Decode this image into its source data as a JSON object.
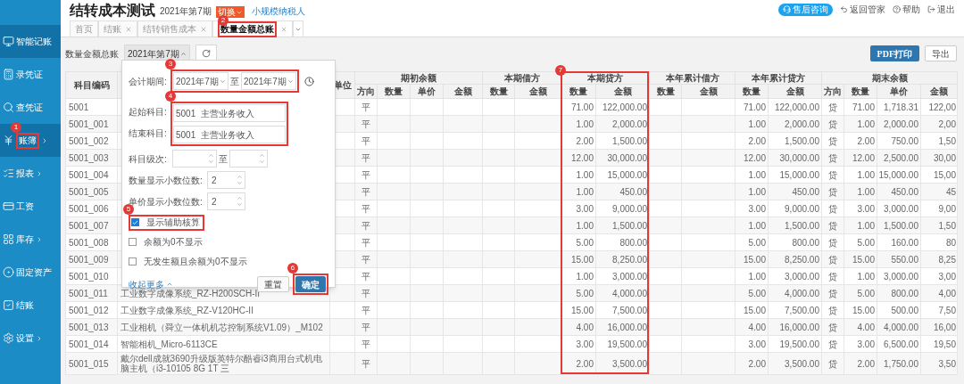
{
  "sidebar": {
    "items": [
      {
        "label": "智能记账",
        "selected": true,
        "submenu": false
      },
      {
        "label": "录凭证",
        "selected": false,
        "submenu": false
      },
      {
        "label": "查凭证",
        "selected": false,
        "submenu": false
      },
      {
        "label": "账簿",
        "selected": true,
        "submenu": true,
        "marker": "1"
      },
      {
        "label": "报表",
        "selected": false,
        "submenu": true
      },
      {
        "label": "工资",
        "selected": false,
        "submenu": false
      },
      {
        "label": "库存",
        "selected": false,
        "submenu": true
      },
      {
        "label": "固定资产",
        "selected": false,
        "submenu": false
      },
      {
        "label": "结账",
        "selected": false,
        "submenu": false
      },
      {
        "label": "设置",
        "selected": false,
        "submenu": true
      }
    ]
  },
  "header": {
    "title": "结转成本测试",
    "period": "2021年第7期",
    "switch_button": "切换",
    "taxpayer_link": "小规模纳税人",
    "links": [
      {
        "label": "售后咨询",
        "kind": "pill"
      },
      {
        "label": "返回管家",
        "kind": "link"
      },
      {
        "label": "帮助",
        "kind": "link"
      },
      {
        "label": "退出",
        "kind": "link"
      }
    ]
  },
  "tabs": [
    {
      "label": "首页",
      "selected": false,
      "closable": false
    },
    {
      "label": "结账",
      "selected": false,
      "closable": true
    },
    {
      "label": "结转销售成本",
      "selected": false,
      "closable": true
    },
    {
      "label": "数量金额总账",
      "selected": true,
      "closable": true,
      "marker": "2"
    }
  ],
  "toolbar": {
    "label": "数量金额总账",
    "period_select": "2021年第7期",
    "print_button": "PDF打印",
    "export_button": "导出"
  },
  "filter_panel": {
    "period_label": "会计期间:",
    "period_from": "2021年7期",
    "period_sep": "至",
    "period_to": "2021年7期",
    "period_marker": "3",
    "start_subject_label": "起始科目:",
    "start_subject": "5001  主营业务收入",
    "end_subject_label": "结束科目:",
    "end_subject": "5001  主营业务收入",
    "subject_marker": "4",
    "level_label": "科目级次:",
    "level_sep": "至",
    "qty_decimals_label": "数量显示小数位数:",
    "qty_decimals": "2",
    "price_decimals_label": "单价显示小数位数:",
    "price_decimals": "2",
    "options": [
      {
        "label": "显示辅助核算",
        "checked": true,
        "marker": "5"
      },
      {
        "label": "余额为0不显示",
        "checked": false
      },
      {
        "label": "无发生额且余额为0不显示",
        "checked": false
      }
    ],
    "collapse_link": "收起更多",
    "reset_button": "重置",
    "confirm_button": "确定",
    "confirm_marker": "6"
  },
  "table": {
    "code_header": "科目编码",
    "unit_header": "单位",
    "groups": [
      {
        "label": "期初余额",
        "columns": [
          "方向",
          "数量",
          "单价",
          "金额"
        ]
      },
      {
        "label": "本期借方",
        "columns": [
          "数量",
          "金额"
        ]
      },
      {
        "label": "本期贷方",
        "columns": [
          "数量",
          "金额"
        ],
        "marker": "7"
      },
      {
        "label": "本年累计借方",
        "columns": [
          "数量",
          "金额"
        ]
      },
      {
        "label": "本年累计贷方",
        "columns": [
          "数量",
          "金额"
        ]
      },
      {
        "label": "期末余额",
        "columns": [
          "方向",
          "数量",
          "单价",
          "金额"
        ]
      }
    ],
    "rows": [
      {
        "code": "5001",
        "open_dir": "平",
        "cr_qty": "71.00",
        "cr_amt": "122,000.00",
        "ytd_cr_qty": "71.00",
        "ytd_cr_amt": "122,000.00",
        "close_dir": "贷",
        "close_qty": "71.00",
        "close_price": "1,718.31",
        "close_amt": "122,00"
      },
      {
        "code": "5001_001",
        "open_dir": "平",
        "cr_qty": "1.00",
        "cr_amt": "2,000.00",
        "ytd_cr_qty": "1.00",
        "ytd_cr_amt": "2,000.00",
        "close_dir": "贷",
        "close_qty": "1.00",
        "close_price": "2,000.00",
        "close_amt": "2,00"
      },
      {
        "code": "5001_002",
        "open_dir": "平",
        "cr_qty": "2.00",
        "cr_amt": "1,500.00",
        "ytd_cr_qty": "2.00",
        "ytd_cr_amt": "1,500.00",
        "close_dir": "贷",
        "close_qty": "2.00",
        "close_price": "750.00",
        "close_amt": "1,50"
      },
      {
        "code": "5001_003",
        "open_dir": "平",
        "cr_qty": "12.00",
        "cr_amt": "30,000.00",
        "ytd_cr_qty": "12.00",
        "ytd_cr_amt": "30,000.00",
        "close_dir": "贷",
        "close_qty": "12.00",
        "close_price": "2,500.00",
        "close_amt": "30,00"
      },
      {
        "code": "5001_004",
        "open_dir": "平",
        "cr_qty": "1.00",
        "cr_amt": "15,000.00",
        "ytd_cr_qty": "1.00",
        "ytd_cr_amt": "15,000.00",
        "close_dir": "贷",
        "close_qty": "1.00",
        "close_price": "15,000.00",
        "close_amt": "15,00"
      },
      {
        "code": "5001_005",
        "open_dir": "平",
        "cr_qty": "1.00",
        "cr_amt": "450.00",
        "ytd_cr_qty": "1.00",
        "ytd_cr_amt": "450.00",
        "close_dir": "贷",
        "close_qty": "1.00",
        "close_price": "450.00",
        "close_amt": "45"
      },
      {
        "code": "5001_006",
        "open_dir": "平",
        "cr_qty": "3.00",
        "cr_amt": "9,000.00",
        "ytd_cr_qty": "3.00",
        "ytd_cr_amt": "9,000.00",
        "close_dir": "贷",
        "close_qty": "3.00",
        "close_price": "3,000.00",
        "close_amt": "9,00"
      },
      {
        "code": "5001_007",
        "open_dir": "平",
        "cr_qty": "1.00",
        "cr_amt": "1,500.00",
        "ytd_cr_qty": "1.00",
        "ytd_cr_amt": "1,500.00",
        "close_dir": "贷",
        "close_qty": "1.00",
        "close_price": "1,500.00",
        "close_amt": "1,50"
      },
      {
        "code": "5001_008",
        "open_dir": "平",
        "cr_qty": "5.00",
        "cr_amt": "800.00",
        "ytd_cr_qty": "5.00",
        "ytd_cr_amt": "800.00",
        "close_dir": "贷",
        "close_qty": "5.00",
        "close_price": "160.00",
        "close_amt": "80"
      },
      {
        "code": "5001_009",
        "open_dir": "平",
        "cr_qty": "15.00",
        "cr_amt": "8,250.00",
        "ytd_cr_qty": "15.00",
        "ytd_cr_amt": "8,250.00",
        "close_dir": "贷",
        "close_qty": "15.00",
        "close_price": "550.00",
        "close_amt": "8,25"
      },
      {
        "code": "5001_010",
        "open_dir": "平",
        "cr_qty": "1.00",
        "cr_amt": "3,000.00",
        "ytd_cr_qty": "1.00",
        "ytd_cr_amt": "3,000.00",
        "close_dir": "贷",
        "close_qty": "1.00",
        "close_price": "3,000.00",
        "close_amt": "3,00"
      },
      {
        "code": "5001_011",
        "name": "工业数字成像系统_RZ-H200SCH-II",
        "open_dir": "平",
        "cr_qty": "5.00",
        "cr_amt": "4,000.00",
        "ytd_cr_qty": "5.00",
        "ytd_cr_amt": "4,000.00",
        "close_dir": "贷",
        "close_qty": "5.00",
        "close_price": "800.00",
        "close_amt": "4,00"
      },
      {
        "code": "5001_012",
        "name": "工业数字成像系统_RZ-V120HC-II",
        "open_dir": "平",
        "cr_qty": "15.00",
        "cr_amt": "7,500.00",
        "ytd_cr_qty": "15.00",
        "ytd_cr_amt": "7,500.00",
        "close_dir": "贷",
        "close_qty": "15.00",
        "close_price": "500.00",
        "close_amt": "7,50"
      },
      {
        "code": "5001_013",
        "name": "工业相机（舜立一体机机芯控制系统V1.09）_M102",
        "open_dir": "平",
        "cr_qty": "4.00",
        "cr_amt": "16,000.00",
        "ytd_cr_qty": "4.00",
        "ytd_cr_amt": "16,000.00",
        "close_dir": "贷",
        "close_qty": "4.00",
        "close_price": "4,000.00",
        "close_amt": "16,00"
      },
      {
        "code": "5001_014",
        "name": "智能相机_Micro-6113CE",
        "open_dir": "平",
        "cr_qty": "3.00",
        "cr_amt": "19,500.00",
        "ytd_cr_qty": "3.00",
        "ytd_cr_amt": "19,500.00",
        "close_dir": "贷",
        "close_qty": "3.00",
        "close_price": "6,500.00",
        "close_amt": "19,50"
      },
      {
        "code": "5001_015",
        "name": "戴尔dell成就3690升级版英特尔酷睿i3商用台式机电脑主机（i3-10105 8G 1T 三",
        "open_dir": "平",
        "cr_qty": "2.00",
        "cr_amt": "3,500.00",
        "ytd_cr_qty": "2.00",
        "ytd_cr_amt": "3,500.00",
        "close_dir": "贷",
        "close_qty": "2.00",
        "close_price": "1,750.00",
        "close_amt": "3,50"
      }
    ]
  }
}
